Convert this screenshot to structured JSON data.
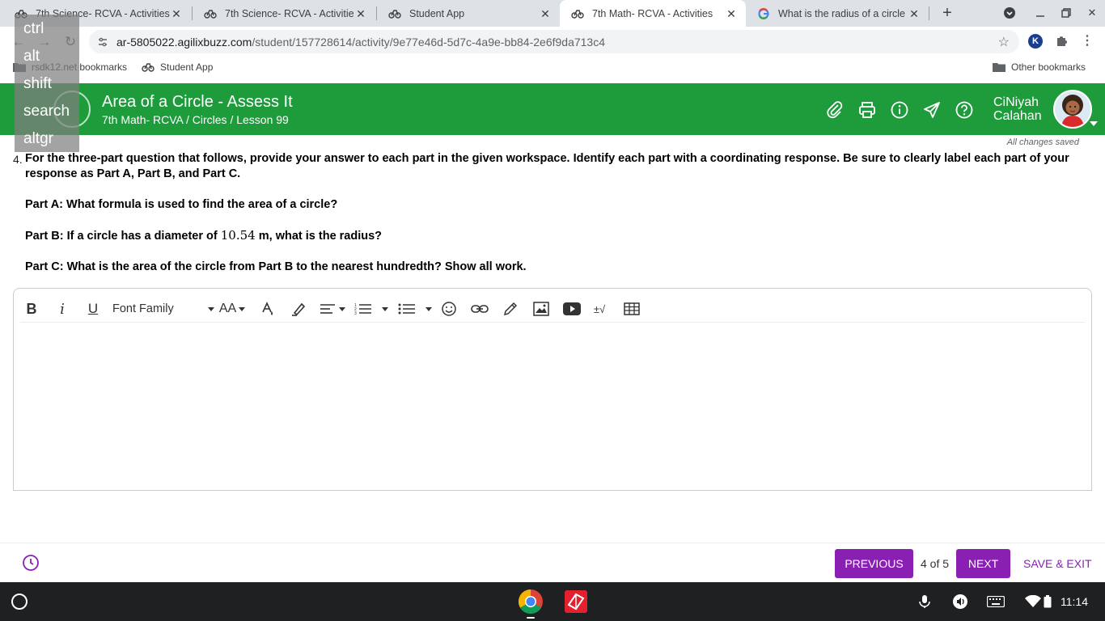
{
  "browser": {
    "tabs": [
      {
        "label": "7th Science- RCVA - Activities",
        "icon": "buzz-icon",
        "active": false
      },
      {
        "label": "7th Science- RCVA - Activities",
        "icon": "buzz-icon",
        "active": false
      },
      {
        "label": "Student App",
        "icon": "buzz-icon",
        "active": false
      },
      {
        "label": "7th Math- RCVA - Activities",
        "icon": "buzz-icon",
        "active": true
      },
      {
        "label": "What is the radius of a circle w",
        "icon": "google-icon",
        "active": false
      }
    ],
    "url_host": "ar-5805022.agilixbuzz.com",
    "url_path": "/student/157728614/activity/9e77e46d-5d7c-4a9e-bb84-2e6f9da713c4",
    "bookmarks": [
      {
        "label": "rsdk12.net bookmarks",
        "icon": "folder-icon"
      },
      {
        "label": "Student App",
        "icon": "buzz-icon"
      }
    ],
    "other_bookmarks": "Other bookmarks"
  },
  "modifier_overlay": [
    "ctrl",
    "alt",
    "shift",
    "search",
    "altgr"
  ],
  "header": {
    "title": "Area of a Circle - Assess It",
    "breadcrumb": "7th Math- RCVA / Circles / Lesson 99",
    "user_first": "CiNiyah",
    "user_last": "Calahan",
    "color": "#1e9c3c"
  },
  "status": {
    "saved": "All changes saved"
  },
  "question": {
    "number": "4.",
    "intro": "For the three-part question that follows, provide your answer to each part in the given workspace. Identify each part with a coordinating response. Be sure to clearly label each part of your response as Part A, Part B, and Part C.",
    "part_a": "Part A: What formula is used to find the area of a circle?",
    "part_b_pre": "Part B: If a circle has a diameter of",
    "part_b_value": "10.54",
    "part_b_post": "m, what is the radius?",
    "part_c": "Part C: What is the area of the circle from Part B to the nearest hundredth? Show all work."
  },
  "editor": {
    "font_family_label": "Font Family",
    "font_size_label": "AA",
    "special_char_label": "±√",
    "content": ""
  },
  "nav": {
    "previous": "PREVIOUS",
    "page": "4 of 5",
    "next": "NEXT",
    "save_exit": "SAVE & EXIT",
    "accent": "#8a1fb3"
  },
  "shelf": {
    "time": "11:14"
  }
}
